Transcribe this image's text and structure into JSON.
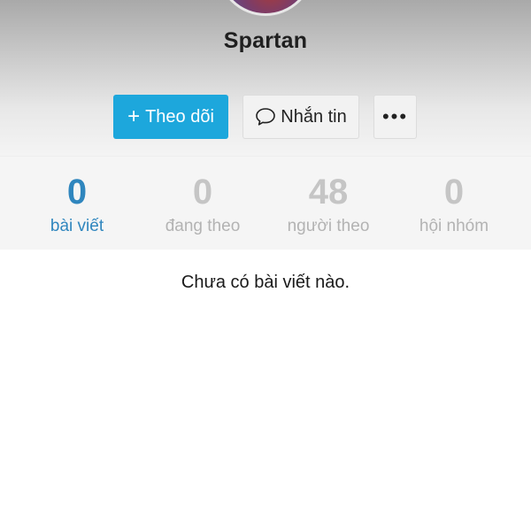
{
  "profile": {
    "name": "Spartan"
  },
  "actions": {
    "follow_label": "Theo dõi",
    "message_label": "Nhắn tin",
    "more_label": "•••"
  },
  "stats": [
    {
      "value": "0",
      "label": "bài viết"
    },
    {
      "value": "0",
      "label": "đang theo"
    },
    {
      "value": "48",
      "label": "người theo"
    },
    {
      "value": "0",
      "label": "hội nhóm"
    }
  ],
  "empty_state": {
    "message": "Chưa có bài viết nào."
  },
  "colors": {
    "accent": "#1da7dc",
    "active_tab": "#2f86be",
    "inactive_tab": "#b3b3b3"
  },
  "icons": {
    "follow": "plus-icon",
    "message": "chat-bubble-icon",
    "more": "more-dots-icon"
  }
}
